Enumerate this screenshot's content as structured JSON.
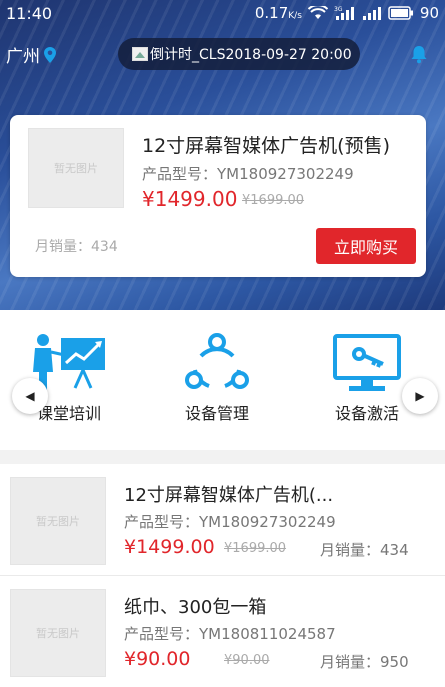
{
  "status_bar": {
    "time": "11:40",
    "speed": "0.17",
    "speed_unit": "K/s",
    "network": "3G",
    "battery": "90"
  },
  "header": {
    "city": "广州",
    "marquee_text": "倒计时_CLS2018-09-27 20:00"
  },
  "featured": {
    "image_placeholder": "暂无图片",
    "title": "12寸屏幕智媒体广告机(预售)",
    "model": "产品型号：YM180927302249",
    "price": "¥1499.00",
    "old_price": "¥1699.00",
    "sales": "月销量：434",
    "buy_label": "立即购买"
  },
  "categories": [
    {
      "label": "课堂培训",
      "icon": "training-icon"
    },
    {
      "label": "设备管理",
      "icon": "share-network-icon"
    },
    {
      "label": "设备激活",
      "icon": "activation-monitor-icon"
    }
  ],
  "products": [
    {
      "image_placeholder": "暂无图片",
      "title": "12寸屏幕智媒体广告机(...",
      "model": "产品型号：YM180927302249",
      "price": "¥1499.00",
      "old_price": "¥1699.00",
      "sales": "月销量：434"
    },
    {
      "image_placeholder": "暂无图片",
      "title": "纸巾、300包一箱",
      "model": "产品型号：YM180811024587",
      "price": "¥90.00",
      "old_price": "¥90.00",
      "sales": "月销量：950"
    }
  ],
  "colors": {
    "accent": "#1aa0e8",
    "price": "#e1262b",
    "button": "#e1262b"
  }
}
